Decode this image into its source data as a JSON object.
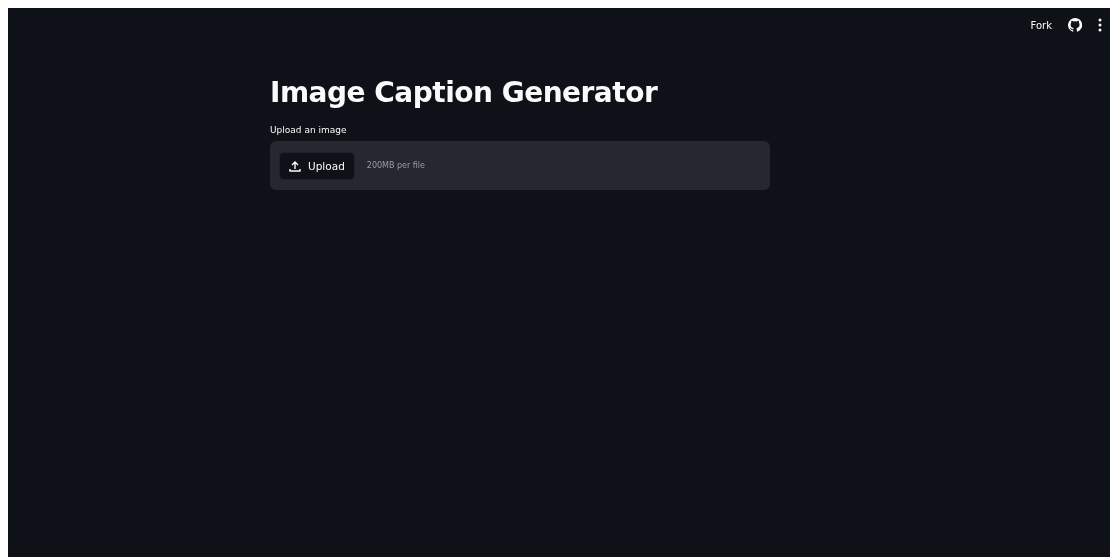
{
  "header": {
    "fork_label": "Fork"
  },
  "title": "Image Caption Generator",
  "uploader": {
    "label": "Upload an image",
    "button": "Upload",
    "limit": "200MB per file"
  }
}
